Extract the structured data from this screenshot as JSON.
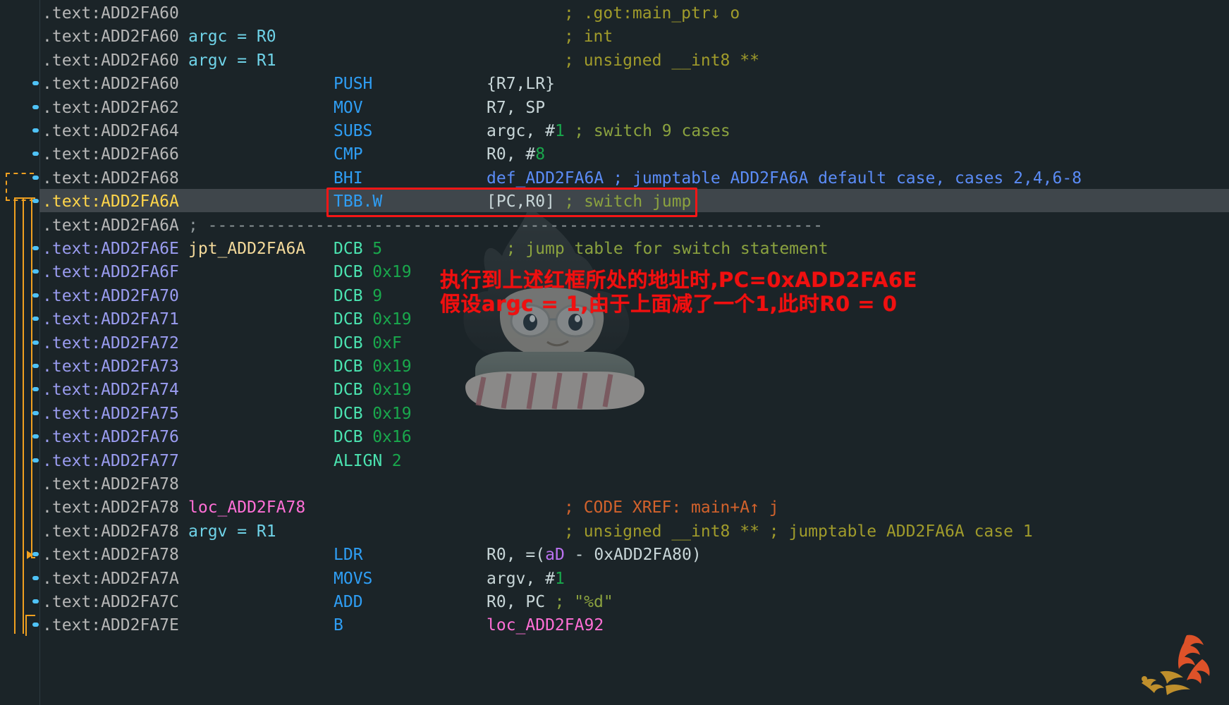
{
  "app": {
    "view": "IDA Pro disassembly (IDA View-A)",
    "segment": ".text",
    "architecture": "ARM Thumb"
  },
  "colors": {
    "background": "#1b2428",
    "address": "#b7b7b7",
    "address_highlight": "#ffd54a",
    "address_jumptable": "#9a9cf0",
    "mnemonic": "#2f9ef4",
    "data_mnemonic": "#4be3b0",
    "number": "#19a84c",
    "comment": "#8ba23f",
    "xref_comment": "#d2622c",
    "loc_label": "#ff6fd6",
    "func_label": "#f3d99a",
    "flow_arrow": "#f0a020",
    "breakpoint_dot": "#4fc3f7",
    "selection": "#3f464b",
    "annotation_red": "#f01010"
  },
  "annotations": {
    "red_box_target": "TBB.W  [PC,R0] ; switch jump",
    "notes": [
      {
        "id": "note-1",
        "text": "执行到上述红框所处的地址时,PC=0xADD2FA6E"
      },
      {
        "id": "note-2",
        "text": "假设argc = 1,由于上面减了一个1,此时R0 = 0"
      }
    ]
  },
  "lines": [
    {
      "address": ".text:ADD2FA60",
      "label": "",
      "mnemonic": "",
      "operands": "",
      "comment": "; .got:main_ptr↓ o",
      "breakpoint": false,
      "selected": false,
      "comment_style": "olive"
    },
    {
      "address": ".text:ADD2FA60",
      "label": "argc = R0",
      "mnemonic": "",
      "operands": "",
      "comment": "; int",
      "breakpoint": false,
      "selected": false,
      "comment_style": "olive"
    },
    {
      "address": ".text:ADD2FA60",
      "label": "argv = R1",
      "mnemonic": "",
      "operands": "",
      "comment": "; unsigned __int8 **",
      "breakpoint": false,
      "selected": false,
      "comment_style": "olive"
    },
    {
      "address": ".text:ADD2FA60",
      "label": "",
      "mnemonic": "PUSH",
      "operands": "{R7,LR}",
      "comment": "",
      "breakpoint": true,
      "selected": false
    },
    {
      "address": ".text:ADD2FA62",
      "label": "",
      "mnemonic": "MOV",
      "operands": "R7, SP",
      "comment": "",
      "breakpoint": true,
      "selected": false
    },
    {
      "address": ".text:ADD2FA64",
      "label": "",
      "mnemonic": "SUBS",
      "operands": "argc, #1",
      "comment": "; switch 9 cases",
      "breakpoint": true,
      "selected": false
    },
    {
      "address": ".text:ADD2FA66",
      "label": "",
      "mnemonic": "CMP",
      "operands": "R0, #8",
      "comment": "",
      "breakpoint": true,
      "selected": false
    },
    {
      "address": ".text:ADD2FA68",
      "label": "",
      "mnemonic": "BHI",
      "operands": "def_ADD2FA6A",
      "comment": "; jumptable ADD2FA6A default case, cases 2,4,6-8",
      "breakpoint": true,
      "selected": false
    },
    {
      "address": ".text:ADD2FA6A",
      "label": "",
      "mnemonic": "TBB.W",
      "operands": "[PC,R0]",
      "comment": "; switch jump",
      "breakpoint": true,
      "selected": true
    },
    {
      "address": ".text:ADD2FA6A",
      "label": "",
      "mnemonic": "",
      "operands": "",
      "comment": "; ---------------------------------------------------------------",
      "breakpoint": false,
      "selected": false,
      "separator": true
    },
    {
      "address": ".text:ADD2FA6E",
      "label": "jpt_ADD2FA6A",
      "mnemonic": "DCB",
      "operands": "5",
      "comment": "; jump table for switch statement",
      "breakpoint": true,
      "selected": false,
      "data": true
    },
    {
      "address": ".text:ADD2FA6F",
      "label": "",
      "mnemonic": "DCB",
      "operands": "0x19",
      "comment": "",
      "breakpoint": true,
      "selected": false,
      "data": true
    },
    {
      "address": ".text:ADD2FA70",
      "label": "",
      "mnemonic": "DCB",
      "operands": "9",
      "comment": "",
      "breakpoint": true,
      "selected": false,
      "data": true
    },
    {
      "address": ".text:ADD2FA71",
      "label": "",
      "mnemonic": "DCB",
      "operands": "0x19",
      "comment": "",
      "breakpoint": true,
      "selected": false,
      "data": true
    },
    {
      "address": ".text:ADD2FA72",
      "label": "",
      "mnemonic": "DCB",
      "operands": "0xF",
      "comment": "",
      "breakpoint": true,
      "selected": false,
      "data": true
    },
    {
      "address": ".text:ADD2FA73",
      "label": "",
      "mnemonic": "DCB",
      "operands": "0x19",
      "comment": "",
      "breakpoint": true,
      "selected": false,
      "data": true
    },
    {
      "address": ".text:ADD2FA74",
      "label": "",
      "mnemonic": "DCB",
      "operands": "0x19",
      "comment": "",
      "breakpoint": true,
      "selected": false,
      "data": true
    },
    {
      "address": ".text:ADD2FA75",
      "label": "",
      "mnemonic": "DCB",
      "operands": "0x19",
      "comment": "",
      "breakpoint": true,
      "selected": false,
      "data": true
    },
    {
      "address": ".text:ADD2FA76",
      "label": "",
      "mnemonic": "DCB",
      "operands": "0x16",
      "comment": "",
      "breakpoint": true,
      "selected": false,
      "data": true
    },
    {
      "address": ".text:ADD2FA77",
      "label": "",
      "mnemonic": "ALIGN",
      "operands": "2",
      "comment": "",
      "breakpoint": true,
      "selected": false,
      "data": true
    },
    {
      "address": ".text:ADD2FA78",
      "label": "",
      "mnemonic": "",
      "operands": "",
      "comment": "",
      "breakpoint": false,
      "selected": false
    },
    {
      "address": ".text:ADD2FA78",
      "label": "loc_ADD2FA78",
      "mnemonic": "",
      "operands": "",
      "comment": "; CODE XREF: main+A↑ j",
      "breakpoint": false,
      "selected": false,
      "comment_style": "xref"
    },
    {
      "address": ".text:ADD2FA78",
      "label": "argv = R1",
      "mnemonic": "",
      "operands": "",
      "comment": "; unsigned __int8 ** ; jumptable ADD2FA6A case 1",
      "breakpoint": false,
      "selected": false,
      "comment_style": "olive"
    },
    {
      "address": ".text:ADD2FA78",
      "label": "",
      "mnemonic": "LDR",
      "operands": "R0, =(aD - 0xADD2FA80)",
      "comment": "",
      "breakpoint": true,
      "selected": false,
      "arrow_target": true
    },
    {
      "address": ".text:ADD2FA7A",
      "label": "",
      "mnemonic": "MOVS",
      "operands": "argv, #1",
      "comment": "",
      "breakpoint": true,
      "selected": false
    },
    {
      "address": ".text:ADD2FA7C",
      "label": "",
      "mnemonic": "ADD",
      "operands": "R0, PC",
      "comment": "; \"%d\"",
      "breakpoint": true,
      "selected": false
    },
    {
      "address": ".text:ADD2FA7E",
      "label": "",
      "mnemonic": "B",
      "operands": "loc_ADD2FA92",
      "comment": "",
      "breakpoint": true,
      "selected": false
    }
  ]
}
